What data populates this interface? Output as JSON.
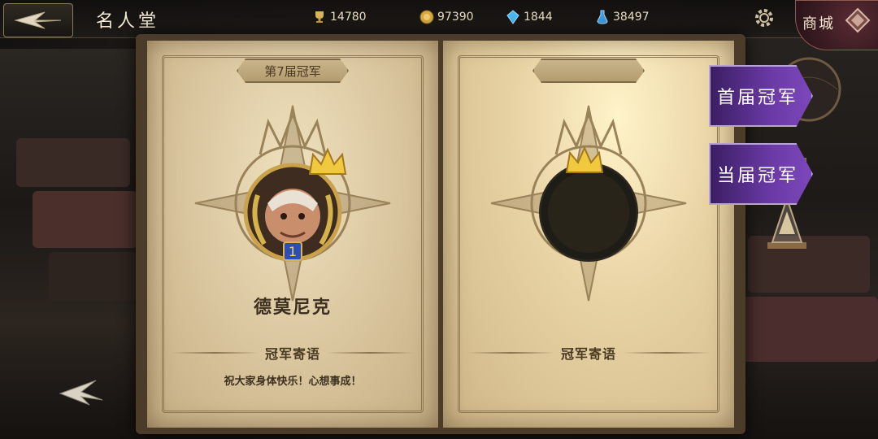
{
  "header": {
    "title": "名人堂",
    "shop_label": "商城"
  },
  "resources": [
    {
      "name": "trophy",
      "icon": "trophy-icon",
      "value": "14780"
    },
    {
      "name": "gold",
      "icon": "gold-coin-icon",
      "value": "97390"
    },
    {
      "name": "crystal",
      "icon": "blue-crystal-icon",
      "value": "1844"
    },
    {
      "name": "potion",
      "icon": "potion-icon",
      "value": "38497"
    }
  ],
  "left_page": {
    "banner": "第7届冠军",
    "champion_name": "德莫尼克",
    "message_title": "冠军寄语",
    "message": "祝大家身体快乐！心想事成！"
  },
  "right_page": {
    "banner": "",
    "message_title": "冠军寄语"
  },
  "tabs": {
    "first": "首届冠军",
    "current": "当届冠军"
  },
  "colors": {
    "tab_purple": "#6a3aa6",
    "parchment": "#e6d3ad",
    "shop_red": "#5b2b34"
  }
}
